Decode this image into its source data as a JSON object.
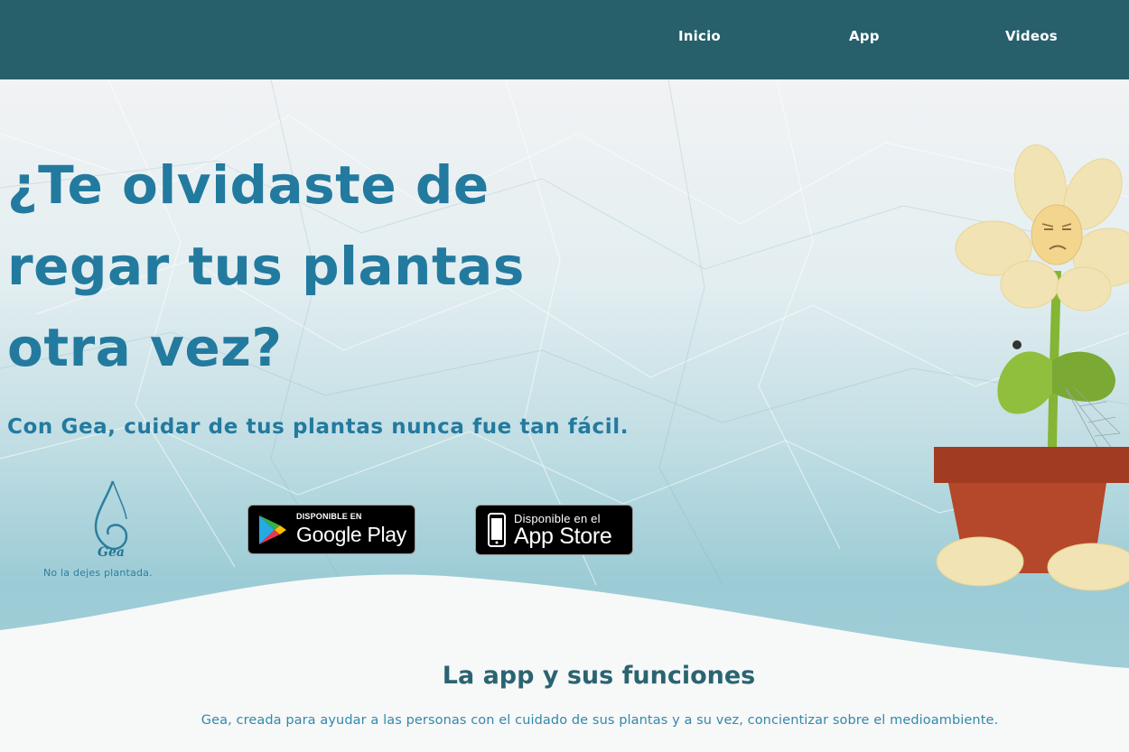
{
  "nav": {
    "items": [
      {
        "label": "Inicio"
      },
      {
        "label": "App"
      },
      {
        "label": "Videos"
      }
    ]
  },
  "hero": {
    "headline_lines": [
      "¿Te olvidaste de",
      "regar tus plantas",
      "otra vez?"
    ],
    "tagline": "Con Gea, cuidar de tus plantas nunca fue tan fácil."
  },
  "logo": {
    "name": "Gea",
    "slogan": "No la dejes plantada."
  },
  "badges": {
    "google": {
      "small": "DISPONIBLE EN",
      "big": "Google Play"
    },
    "apple": {
      "small": "Disponible en el",
      "big": "App Store"
    }
  },
  "section": {
    "title": "La app y sus funciones",
    "text": "Gea, creada para ayudar a las personas con el cuidado de sus plantas y a su vez, concientizar sobre el medioambiente."
  },
  "colors": {
    "nav_bg": "#275f6b",
    "headline": "#237a9f",
    "section_title": "#2b6471",
    "pot": "#b5472a"
  },
  "icons": [
    "google-play-icon",
    "apple-phone-icon",
    "water-drop-logo-icon",
    "sad-flower-illustration"
  ]
}
